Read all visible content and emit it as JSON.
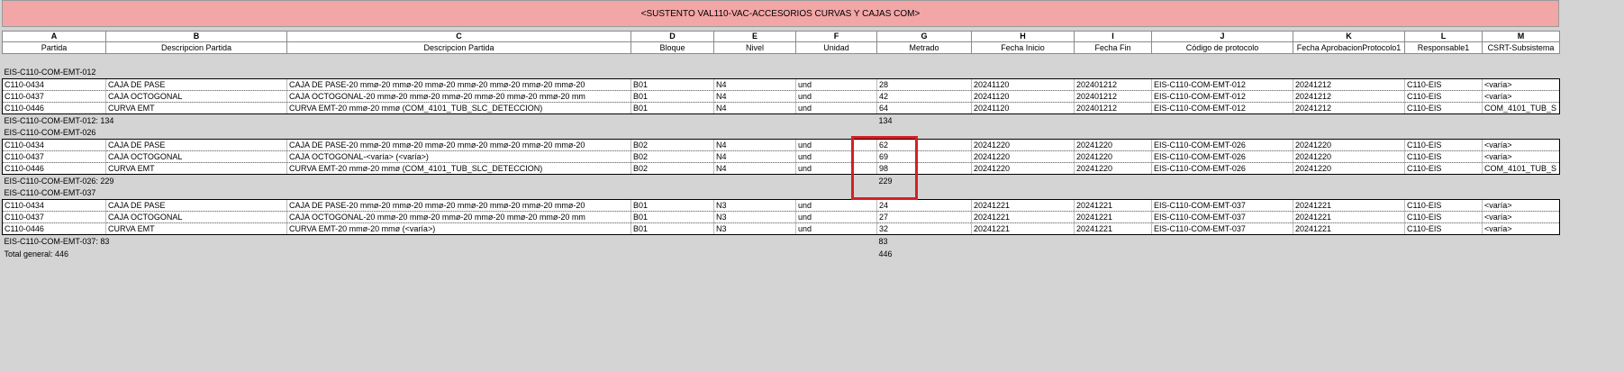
{
  "title": "<SUSTENTO VAL110-VAC-ACCESORIOS CURVAS Y CAJAS COM>",
  "column_letters": [
    "A",
    "B",
    "C",
    "D",
    "E",
    "F",
    "G",
    "H",
    "I",
    "J",
    "K",
    "L",
    "M"
  ],
  "column_headers": [
    "Partida",
    "Descripcion Partida",
    "Descripcion Partida",
    "Bloque",
    "Nivel",
    "Unidad",
    "Metrado",
    "Fecha Inicio",
    "Fecha Fin",
    "Código de protocolo",
    "Fecha AprobacionProtocolo1",
    "Responsable1",
    "CSRT-Subsistema"
  ],
  "groups": [
    {
      "header": "EIS-C110-COM-EMT-012",
      "rows": [
        [
          "C110-0434",
          "CAJA DE PASE",
          "CAJA DE PASE-20 mmø-20 mmø-20 mmø-20 mmø-20 mmø-20 mmø-20 mmø-20",
          "B01",
          "N4",
          "und",
          "28",
          "20241120",
          "202401212",
          "EIS-C110-COM-EMT-012",
          "20241212",
          "C110-EIS",
          "<varía>"
        ],
        [
          "C110-0437",
          "CAJA OCTOGONAL",
          "CAJA OCTOGONAL-20 mmø-20 mmø-20 mmø-20 mmø-20 mmø-20 mmø-20 mm",
          "B01",
          "N4",
          "und",
          "42",
          "20241120",
          "202401212",
          "EIS-C110-COM-EMT-012",
          "20241212",
          "C110-EIS",
          "<varía>"
        ],
        [
          "C110-0446",
          "CURVA EMT",
          "CURVA EMT-20 mmø-20 mmø (COM_4101_TUB_SLC_DETECCION)",
          "B01",
          "N4",
          "und",
          "64",
          "20241120",
          "202401212",
          "EIS-C110-COM-EMT-012",
          "20241212",
          "C110-EIS",
          "COM_4101_TUB_S"
        ]
      ],
      "subtotal_label": "EIS-C110-COM-EMT-012: 134",
      "subtotal_value": "134"
    },
    {
      "header": "EIS-C110-COM-EMT-026",
      "rows": [
        [
          "C110-0434",
          "CAJA DE PASE",
          "CAJA DE PASE-20 mmø-20 mmø-20 mmø-20 mmø-20 mmø-20 mmø-20 mmø-20",
          "B02",
          "N4",
          "und",
          "62",
          "20241220",
          "20241220",
          "EIS-C110-COM-EMT-026",
          "20241220",
          "C110-EIS",
          "<varía>"
        ],
        [
          "C110-0437",
          "CAJA OCTOGONAL",
          "CAJA OCTOGONAL-<varía> (<varía>)",
          "B02",
          "N4",
          "und",
          "69",
          "20241220",
          "20241220",
          "EIS-C110-COM-EMT-026",
          "20241220",
          "C110-EIS",
          "<varía>"
        ],
        [
          "C110-0446",
          "CURVA EMT",
          "CURVA EMT-20 mmø-20 mmø (COM_4101_TUB_SLC_DETECCION)",
          "B02",
          "N4",
          "und",
          "98",
          "20241220",
          "20241220",
          "EIS-C110-COM-EMT-026",
          "20241220",
          "C110-EIS",
          "COM_4101_TUB_S"
        ]
      ],
      "subtotal_label": "EIS-C110-COM-EMT-026: 229",
      "subtotal_value": "229"
    },
    {
      "header": "EIS-C110-COM-EMT-037",
      "rows": [
        [
          "C110-0434",
          "CAJA DE PASE",
          "CAJA DE PASE-20 mmø-20 mmø-20 mmø-20 mmø-20 mmø-20 mmø-20 mmø-20",
          "B01",
          "N3",
          "und",
          "24",
          "20241221",
          "20241221",
          "EIS-C110-COM-EMT-037",
          "20241221",
          "C110-EIS",
          "<varía>"
        ],
        [
          "C110-0437",
          "CAJA OCTOGONAL",
          "CAJA OCTOGONAL-20 mmø-20 mmø-20 mmø-20 mmø-20 mmø-20 mmø-20 mm",
          "B01",
          "N3",
          "und",
          "27",
          "20241221",
          "20241221",
          "EIS-C110-COM-EMT-037",
          "20241221",
          "C110-EIS",
          "<varía>"
        ],
        [
          "C110-0446",
          "CURVA EMT",
          "CURVA EMT-20 mmø-20 mmø (<varía>)",
          "B01",
          "N3",
          "und",
          "32",
          "20241221",
          "20241221",
          "EIS-C110-COM-EMT-037",
          "20241221",
          "C110-EIS",
          "<varía>"
        ]
      ],
      "subtotal_label": "EIS-C110-COM-EMT-037: 83",
      "subtotal_value": "83"
    }
  ],
  "grand_total_label": "Total general: 446",
  "grand_total_value": "446",
  "colors": {
    "title_background": "#f3a6a6",
    "highlight_border": "#d51f27",
    "canvas": "#d4d4d4"
  }
}
